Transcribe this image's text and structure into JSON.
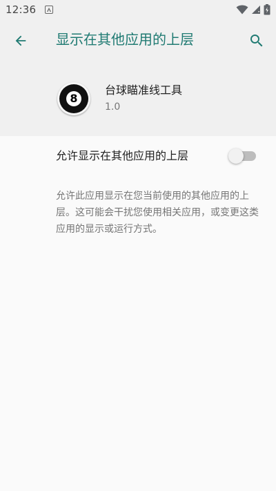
{
  "status_bar": {
    "time": "12:36",
    "icons": [
      "android-a-icon",
      "wifi-icon",
      "signal-icon",
      "battery-icon"
    ]
  },
  "app_bar": {
    "title": "显示在其他应用的上层",
    "back_icon": "arrow-back-icon",
    "search_icon": "search-icon",
    "accent_color": "#1f7a72"
  },
  "app_info": {
    "name": "台球瞄准线工具",
    "version": "1.0",
    "icon": "eight-ball-icon",
    "icon_text": "8"
  },
  "setting": {
    "label": "允许显示在其他应用的上层",
    "enabled": false
  },
  "description": "允许此应用显示在您当前使用的其他应用的上层。这可能会干扰您使用相关应用，或变更这类应用的显示或运行方式。"
}
